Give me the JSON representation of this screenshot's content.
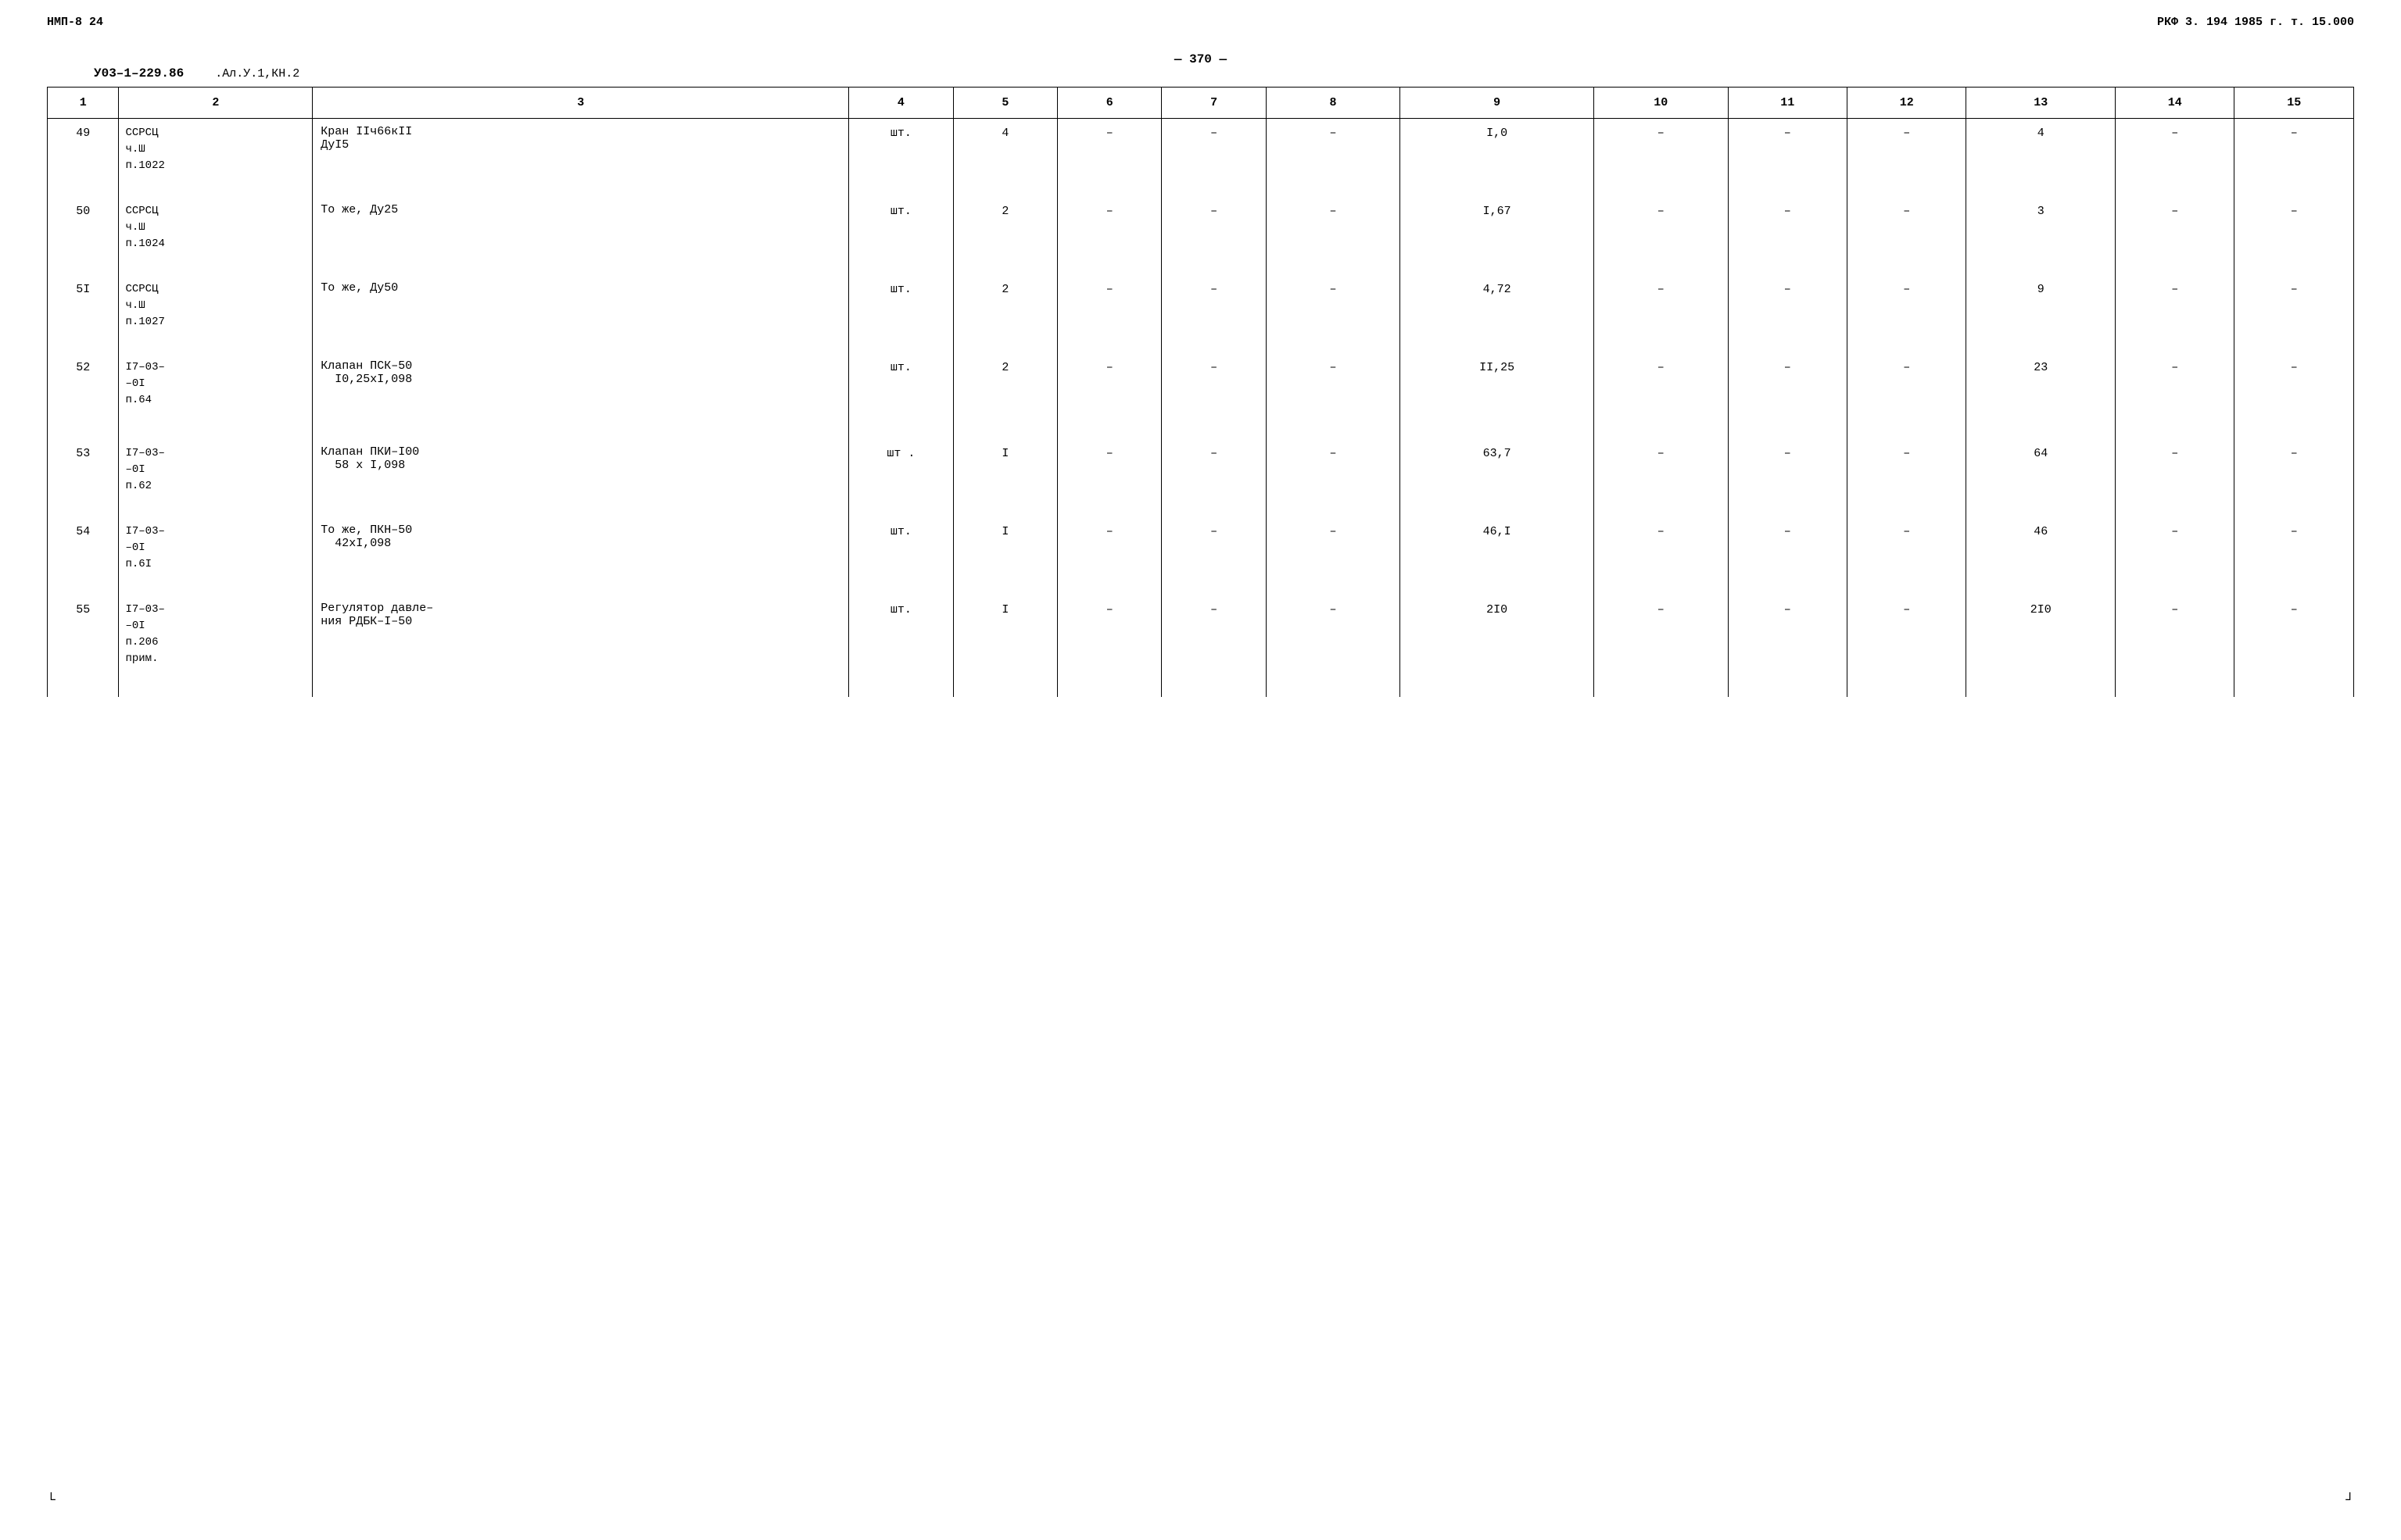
{
  "header": {
    "top_left": "НМП-8 24",
    "top_right": "РКФ 3. 194 1985 г. т. 15.000",
    "doc_number": "У03–1–229.86",
    "doc_refs": ".Ал.У.1,КН.2",
    "page_center": "— 370 —"
  },
  "table": {
    "columns": [
      "1",
      "2",
      "3",
      "4",
      "5",
      "6",
      "7",
      "8",
      "9",
      "10",
      "11",
      "12",
      "13",
      "14",
      "15"
    ],
    "rows": [
      {
        "id": "49",
        "col2": "ССРСЦ\nч.Ш\nп.1022",
        "col3": "Кран IIч66кII\nДуI5",
        "col4": "шт.",
        "col5": "4",
        "col6": "–",
        "col7": "–",
        "col8": "–",
        "col9": "I,0",
        "col10": "–",
        "col11": "–",
        "col12": "–",
        "col13": "4",
        "col14": "–",
        "col15": "–"
      },
      {
        "id": "50",
        "col2": "ССРСЦ\nч.Ш\nп.1024",
        "col3": "То же, Ду25",
        "col4": "шт.",
        "col5": "2",
        "col6": "–",
        "col7": "–",
        "col8": "–",
        "col9": "I,67",
        "col10": "–",
        "col11": "–",
        "col12": "–",
        "col13": "3",
        "col14": "–",
        "col15": "–"
      },
      {
        "id": "5I",
        "col2": "ССРСЦ\nч.Ш\nп.1027",
        "col3": "То же, Ду50",
        "col4": "шт.",
        "col5": "2",
        "col6": "–",
        "col7": "–",
        "col8": "–",
        "col9": "4,72",
        "col10": "–",
        "col11": "–",
        "col12": "–",
        "col13": "9",
        "col14": "–",
        "col15": "–"
      },
      {
        "id": "52",
        "col2": "I7–03–\n–0I\nп.64",
        "col3": "Клапан ПСК–50\n  I0,25хI,098",
        "col4": "шт.",
        "col5": "2",
        "col6": "–",
        "col7": "–",
        "col8": "–",
        "col9": "II,25",
        "col10": "–",
        "col11": "–",
        "col12": "–",
        "col13": "23",
        "col14": "–",
        "col15": "–"
      },
      {
        "id": "53",
        "col2": "I7–03–\n–0I\nп.62",
        "col3": "Клапан ПКИ–I00\n  58 х I,098",
        "col4": "шт .",
        "col5": "I",
        "col6": "–",
        "col7": "–",
        "col8": "–",
        "col9": "63,7",
        "col10": "–",
        "col11": "–",
        "col12": "–",
        "col13": "64",
        "col14": "–",
        "col15": "–"
      },
      {
        "id": "54",
        "col2": "I7–03–\n–0I\nп.6I",
        "col3": "То же, ПКН–50\n  42хI,098",
        "col4": "шт.",
        "col5": "I",
        "col6": "–",
        "col7": "–",
        "col8": "–",
        "col9": "46,I",
        "col10": "–",
        "col11": "–",
        "col12": "–",
        "col13": "46",
        "col14": "–",
        "col15": "–"
      },
      {
        "id": "55",
        "col2": "I7–03–\n–0I\nп.206\nприм.",
        "col3": "Регулятор давле–\nния РДБК–I–50",
        "col4": "шт.",
        "col5": "I",
        "col6": "–",
        "col7": "–",
        "col8": "–",
        "col9": "2I0",
        "col10": "–",
        "col11": "–",
        "col12": "–",
        "col13": "2I0",
        "col14": "–",
        "col15": "–"
      }
    ]
  },
  "corners": {
    "bottom_left": "└",
    "bottom_right": "┘"
  }
}
